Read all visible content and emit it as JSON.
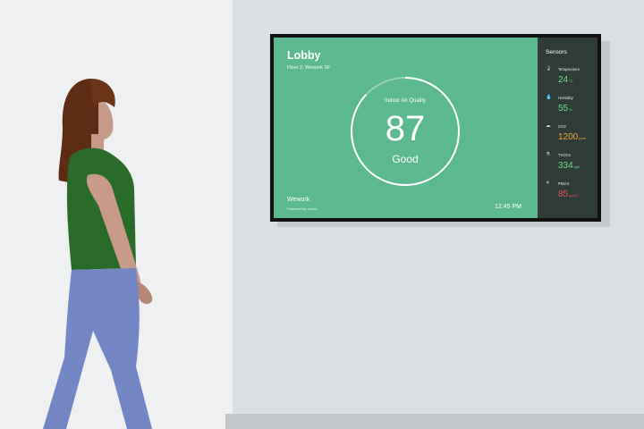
{
  "display": {
    "room_title": "Lobby",
    "room_subtitle": "Floor 2, Wework SF",
    "metric_label": "Indoor Air Quality",
    "score": "87",
    "score_fraction": 0.87,
    "status": "Good",
    "brand": "Wework",
    "powered_by": "Powered by: Awair",
    "time": "12:45 PM",
    "colors": {
      "panel": "#5cb88e",
      "sidebar": "#2f3b36",
      "good": "#6fdc8c",
      "warn": "#f2a33a",
      "bad": "#e0525a"
    }
  },
  "sidebar": {
    "title": "Sensors",
    "sensors": [
      {
        "icon": "thermometer-icon",
        "name": "Temperature",
        "value": "24",
        "unit": "°C",
        "color": "#6fdc8c"
      },
      {
        "icon": "water-drop-icon",
        "name": "Humidity",
        "value": "55",
        "unit": "%",
        "color": "#6fdc8c"
      },
      {
        "icon": "cloud-icon",
        "name": "CO2",
        "value": "1200",
        "unit": "ppm",
        "color": "#f2a33a"
      },
      {
        "icon": "chemical-icon",
        "name": "TVOCs",
        "value": "334",
        "unit": "ppb",
        "color": "#6fdc8c"
      },
      {
        "icon": "particles-icon",
        "name": "PM2.5",
        "value": "85",
        "unit": "μg/m³",
        "color": "#e0525a"
      }
    ]
  }
}
